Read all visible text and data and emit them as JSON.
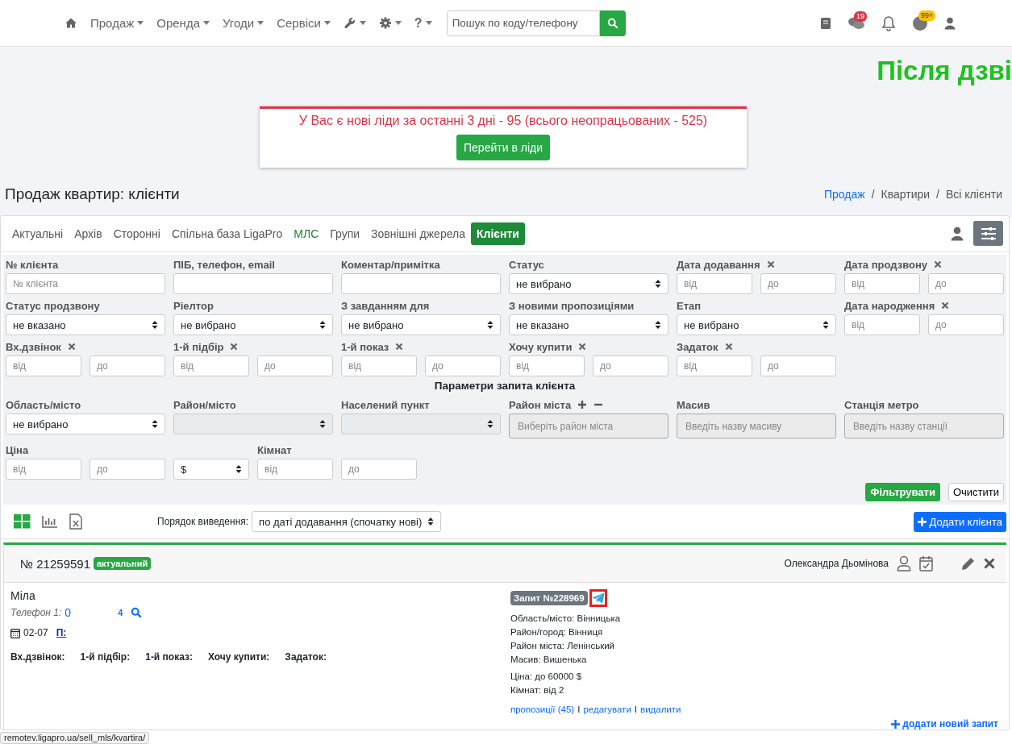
{
  "navbar": {
    "items": [
      {
        "kind": "home",
        "dropdown": false
      },
      {
        "kind": "menu",
        "label": "Продаж",
        "dropdown": true
      },
      {
        "kind": "menu",
        "label": "Оренда",
        "dropdown": true
      },
      {
        "kind": "menu",
        "label": "Угоди",
        "dropdown": true
      },
      {
        "kind": "menu",
        "label": "Сервіси",
        "dropdown": true
      },
      {
        "kind": "wrench",
        "dropdown": true
      },
      {
        "kind": "gear",
        "dropdown": true
      },
      {
        "kind": "menu",
        "label": "?",
        "dropdown": true
      }
    ],
    "search": {
      "placeholder": "Пошук по коду/телефону"
    },
    "right_icons": [
      {
        "kind": "book"
      },
      {
        "kind": "chat",
        "badge": "19",
        "color": "#dc3545"
      },
      {
        "kind": "bell"
      },
      {
        "kind": "coin",
        "badge": "99+",
        "color": "#ffc107"
      },
      {
        "kind": "user"
      }
    ]
  },
  "banner": {
    "text": "Після дзві"
  },
  "alert": {
    "text": "У Вас є нові ліди за останні 3 дні - 95 (всього неопрацьованих - 525)",
    "button": "Перейти в ліди"
  },
  "page_title": "Продаж квартир: клієнти",
  "breadcrumb": [
    {
      "kind": "item",
      "label": "Продаж",
      "link": true
    },
    {
      "kind": "separator",
      "label": "/"
    },
    {
      "kind": "item",
      "label": "Квартири",
      "link": false
    },
    {
      "kind": "separator",
      "label": "/"
    },
    {
      "kind": "item",
      "label": "Всі клієнти",
      "link": false
    }
  ],
  "tabs": [
    {
      "label": "Актуальні",
      "selected": false,
      "color": "#555555"
    },
    {
      "label": "Архів",
      "selected": false,
      "color": "#555555"
    },
    {
      "label": "Сторонні",
      "selected": false,
      "color": "#555555"
    },
    {
      "label": "Спільна база LigaPro",
      "selected": false,
      "color": "#555555"
    },
    {
      "label": "МЛС",
      "selected": false,
      "color": "#1e7e34"
    },
    {
      "label": "Групи",
      "selected": false,
      "color": "#555555"
    },
    {
      "label": "Зовнішні джерела",
      "selected": false,
      "color": "#555555"
    },
    {
      "label": "Клієнти",
      "selected": true,
      "color": "#1e8a3a"
    }
  ],
  "filters": {
    "rows_top": [
      [
        {
          "kind": "input",
          "label": "№ клієнта",
          "placeholder": "№ клієнта",
          "clearable": false,
          "disabled": false
        },
        {
          "kind": "input",
          "label": "ПІБ, телефон, email",
          "clearable": false,
          "disabled": false
        },
        {
          "kind": "input",
          "label": "Коментар/примітка",
          "clearable": false,
          "disabled": false
        },
        {
          "kind": "select",
          "label": "Статус",
          "value": "не вибрано",
          "clearable": false,
          "disabled": false
        },
        {
          "kind": "range",
          "label": "Дата додавання",
          "from": {
            "placeholder": "від"
          },
          "to": {
            "placeholder": "до"
          },
          "clearable": true,
          "disabled": false
        },
        {
          "kind": "range",
          "label": "Дата продзвону",
          "from": {
            "placeholder": "від"
          },
          "to": {
            "placeholder": "до"
          },
          "clearable": true,
          "disabled": false
        }
      ],
      [
        {
          "kind": "select",
          "label": "Статус продзвону",
          "value": "не вказано",
          "clearable": false,
          "disabled": false
        },
        {
          "kind": "select",
          "label": "Ріелтор",
          "value": "не вибрано",
          "clearable": false,
          "disabled": false
        },
        {
          "kind": "select",
          "label": "З завданням для",
          "value": "не вибрано",
          "clearable": false,
          "disabled": false
        },
        {
          "kind": "select",
          "label": "З новими пропозиціями",
          "value": "не вказано",
          "clearable": false,
          "disabled": false
        },
        {
          "kind": "select",
          "label": "Етап",
          "value": "не вибрано",
          "clearable": false,
          "disabled": false
        },
        {
          "kind": "range",
          "label": "Дата народження",
          "from": {
            "placeholder": "від"
          },
          "to": {
            "placeholder": "до"
          },
          "clearable": true,
          "disabled": false
        }
      ],
      [
        {
          "kind": "range",
          "label": "Вх.дзвінок",
          "from": {
            "placeholder": "від"
          },
          "to": {
            "placeholder": "до"
          },
          "clearable": true,
          "disabled": false
        },
        {
          "kind": "range",
          "label": "1-й підбір",
          "from": {
            "placeholder": "від"
          },
          "to": {
            "placeholder": "до"
          },
          "clearable": true,
          "disabled": false
        },
        {
          "kind": "range",
          "label": "1-й показ",
          "from": {
            "placeholder": "від"
          },
          "to": {
            "placeholder": "до"
          },
          "clearable": true,
          "disabled": false
        },
        {
          "kind": "range",
          "label": "Хочу купити",
          "from": {
            "placeholder": "від"
          },
          "to": {
            "placeholder": "до"
          },
          "clearable": true,
          "disabled": false
        },
        {
          "kind": "range",
          "label": "Задаток",
          "from": {
            "placeholder": "від"
          },
          "to": {
            "placeholder": "до"
          },
          "clearable": true,
          "disabled": false
        }
      ]
    ],
    "section_title": "Параметри запита клієнта",
    "rows_bottom": [
      [
        {
          "kind": "select",
          "label": "Область/місто",
          "value": "не вибрано",
          "clearable": false,
          "disabled": false
        },
        {
          "kind": "select",
          "label": "Район/місто",
          "clearable": false,
          "disabled": true
        },
        {
          "kind": "select",
          "label": "Населений пункт",
          "clearable": false,
          "disabled": true
        },
        {
          "kind": "tags",
          "label": "Район міста",
          "placeholder": "Виберіть район міста",
          "clearable": false,
          "disabled": true,
          "add_remove": true
        },
        {
          "kind": "tags",
          "label": "Масив",
          "placeholder": "Введіть назву масиву",
          "clearable": false,
          "disabled": true,
          "add_remove": false
        },
        {
          "kind": "tags",
          "label": "Станція метро",
          "placeholder": "Введіть назву станції",
          "clearable": false,
          "disabled": true,
          "add_remove": false
        }
      ],
      [
        {
          "kind": "range",
          "label": "Ціна",
          "from": {
            "placeholder": "від"
          },
          "to": {
            "placeholder": "до"
          },
          "clearable": false,
          "disabled": false
        },
        {
          "kind": "narrow_select",
          "value": "$",
          "clearable": false,
          "disabled": false
        },
        {
          "kind": "range",
          "label": "Кімнат",
          "from": {
            "placeholder": "від"
          },
          "to": {
            "placeholder": "до"
          },
          "clearable": false,
          "disabled": false
        }
      ]
    ],
    "apply_button": "Фільтрувати",
    "clear_button": "Очистити"
  },
  "toolbar": {
    "sort_label": "Порядок виведення:",
    "sort_value": "по даті додавання (спочатку нові)",
    "add_button": "Додати клієнта"
  },
  "client": {
    "number": "№ 21259591",
    "status": "актуальний",
    "agent": "Олександра Дьомінова",
    "name": "Міла",
    "phone_label": "Телефон 1:",
    "phone_start": "0",
    "phone_end": "4",
    "date": "02-07",
    "note_link": "П:",
    "stats": [
      "Вх.дзвінок:",
      "1-й підбір:",
      "1-й показ:",
      "Хочу купити:",
      "Задаток:"
    ],
    "request": {
      "title": "Запит №228969",
      "telegram_highlighted": true,
      "lines_location": [
        "Область/місто: Вінницька",
        "Район/город: Вінниця",
        "Район міста: Ленінський",
        "Масив: Вишенька"
      ],
      "lines_params": [
        "Ціна: до 60000 $",
        "Кімнат: від 2"
      ],
      "links": [
        {
          "kind": "link",
          "text": "пропозиції (45)"
        },
        {
          "kind": "separator",
          "text": "I"
        },
        {
          "kind": "link",
          "text": "редагувати"
        },
        {
          "kind": "separator",
          "text": "I"
        },
        {
          "kind": "link",
          "text": "видалити"
        }
      ]
    },
    "add_request": "додати новий запит"
  },
  "status_url": "remotev.ligapro.ua/sell_mls/kvartira/"
}
